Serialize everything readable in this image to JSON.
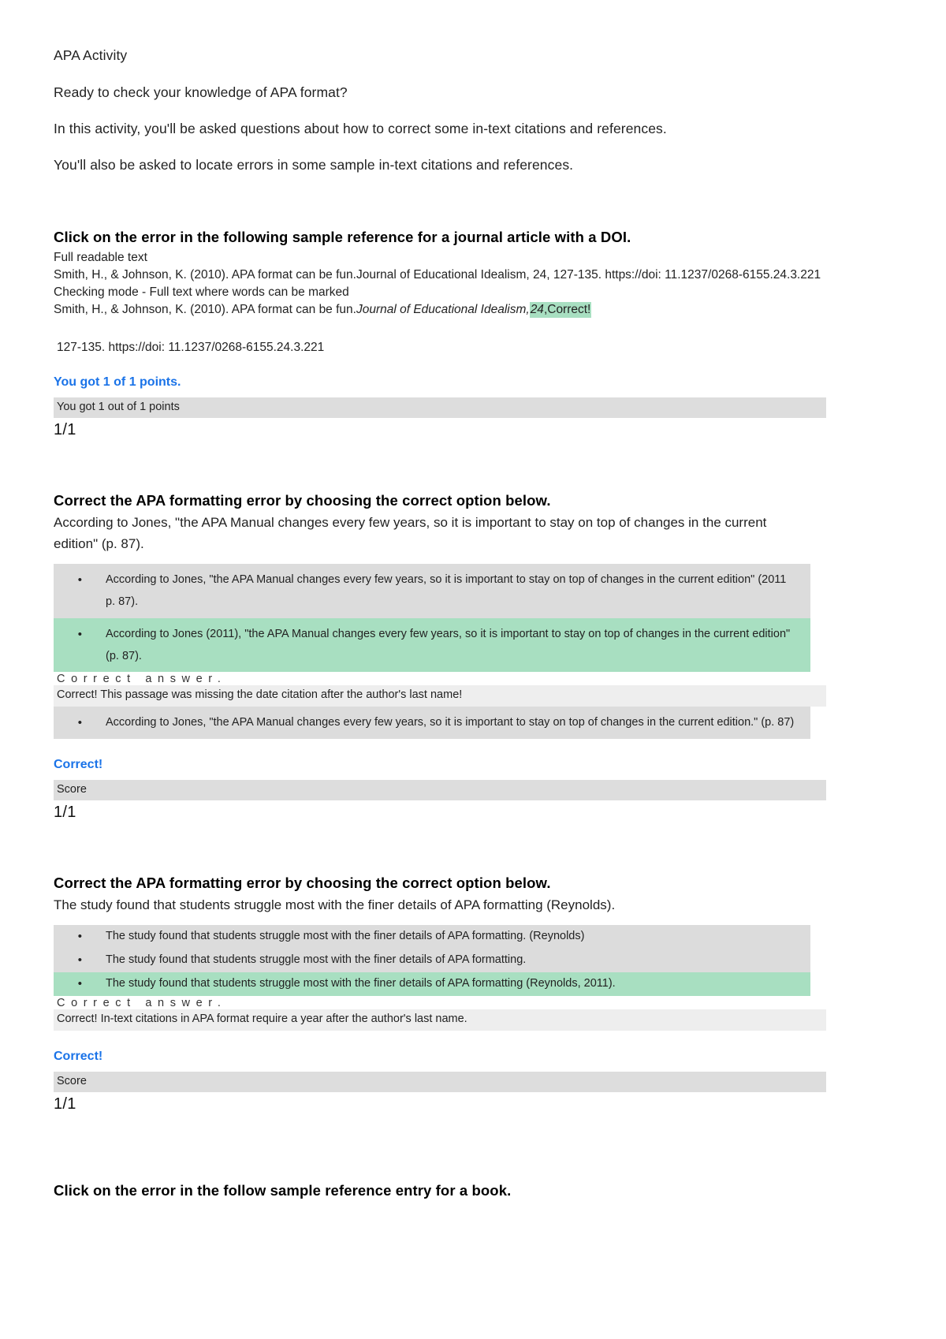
{
  "document": {
    "title": "APA Activity",
    "intro": [
      "Ready to check your knowledge of APA format?",
      "In this activity, you'll be asked questions about how to correct some in-text citations and references.",
      "You'll also be asked to locate errors in some sample in-text citations and references."
    ]
  },
  "q1": {
    "title": "Click on the error in the following sample reference for a journal article with a DOI.",
    "full_readable_label": "Full readable text",
    "full_readable_text": "Smith, H., & Johnson, K. (2010). APA format can be fun.Journal of Educational Idealism, 24, 127-135. https://doi: 11.1237/0268-6155.24.3.221",
    "checking_mode_label": "Checking mode - Full text where words can be marked",
    "marked_prefix": "Smith, H., & Johnson, K. (2010). APA format can be fun.",
    "marked_italic": "Journal of Educational Idealism,",
    "marked_highlight_italic": "24",
    "marked_highlight_rest": ",Correct!",
    "marked_continuation": "127-135. https://doi: 11.1237/0268-6155.24.3.221",
    "feedback": "You got 1 of 1 points.",
    "score_label": "You got 1 out of 1 points",
    "score_value": "1/1"
  },
  "q2": {
    "title": "Correct the APA formatting error by choosing the correct option below.",
    "prompt": "According to Jones, \"the APA Manual changes every few years, so it is important to stay on top of changes in the current edition\" (p. 87).",
    "options": [
      {
        "bullet": "•",
        "text": "According to Jones, \"the APA Manual changes every few years, so it is important to stay on top of changes in the current edition\" (2011 p. 87).",
        "state": "grey"
      },
      {
        "bullet": "•",
        "text": "According to Jones (2011), \"the APA Manual changes every few years, so it is important to stay on top of changes in the current edition\" (p. 87).",
        "state": "green"
      },
      {
        "bullet": "•",
        "text": "According to Jones, \"the APA Manual changes every few years, so it is important to stay on top of changes in the current edition.\" (p. 87)",
        "state": "grey"
      }
    ],
    "correct_answer_label": "Correct answer.",
    "explanation": "Correct! This passage was missing the date citation after the author's last name!",
    "feedback": "Correct!",
    "score_label": "Score",
    "score_value": "1/1"
  },
  "q3": {
    "title": "Correct the APA formatting error by choosing the correct option below.",
    "prompt": "The study found that students struggle most with the finer details of APA formatting (Reynolds).",
    "options": [
      {
        "bullet": "•",
        "text": "The study found that students struggle most with the finer details of APA formatting. (Reynolds)",
        "state": "grey"
      },
      {
        "bullet": "•",
        "text": "The study found that students struggle most with the finer details of APA formatting.",
        "state": "grey"
      },
      {
        "bullet": "•",
        "text": "The study found that students struggle most with the finer details of APA formatting (Reynolds, 2011).",
        "state": "green"
      }
    ],
    "correct_answer_label": "Correct answer.",
    "explanation": "Correct! In-text citations in APA format require a year after the author's last name.",
    "feedback": "Correct!",
    "score_label": "Score",
    "score_value": "1/1"
  },
  "q4": {
    "title": "Click on the error in the follow sample reference entry for a book."
  },
  "colors": {
    "highlight_green": "#a8dfc1",
    "option_grey": "#dcdcdc",
    "score_bar_grey": "#dddddd",
    "feedback_blue": "#1a73e8"
  }
}
